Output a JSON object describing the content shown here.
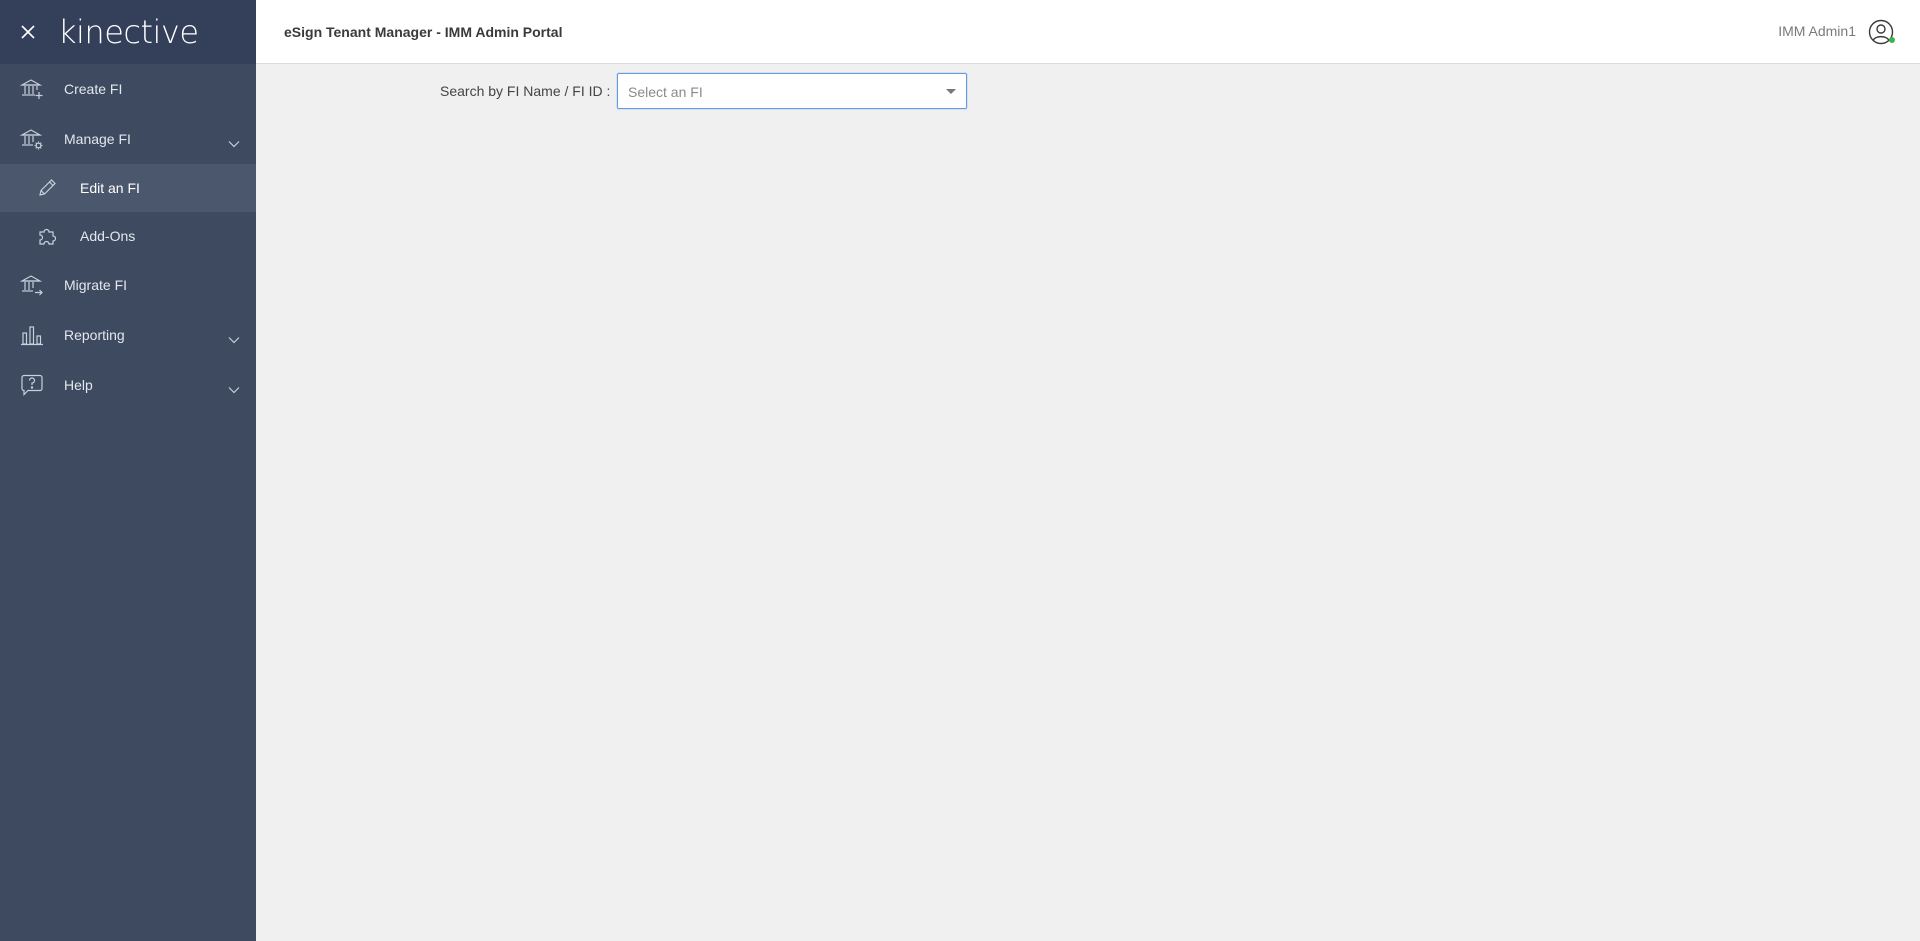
{
  "app": {
    "logo": "kinective",
    "title": "eSign Tenant Manager - IMM Admin Portal"
  },
  "user": {
    "name": "IMM Admin1"
  },
  "sidebar": {
    "items": [
      {
        "label": "Create FI",
        "icon": "bank-add-icon"
      },
      {
        "label": "Manage FI",
        "icon": "bank-settings-icon",
        "expandable": true
      },
      {
        "label": "Edit an FI",
        "icon": "pencil-icon",
        "sub": true,
        "active": true
      },
      {
        "label": "Add-Ons",
        "icon": "puzzle-icon",
        "sub": true
      },
      {
        "label": "Migrate FI",
        "icon": "bank-migrate-icon"
      },
      {
        "label": "Reporting",
        "icon": "bar-chart-icon",
        "expandable": true
      },
      {
        "label": "Help",
        "icon": "help-chat-icon",
        "expandable": true
      }
    ]
  },
  "search": {
    "label": "Search by FI Name / FI ID :",
    "placeholder": "Select an FI"
  },
  "colors": {
    "sidebar_bg": "#3d4a5f",
    "sidebar_header_bg": "#34405a",
    "active_item_bg": "#4b576c",
    "focus_border": "#6a9ae0",
    "status_online": "#3cb44b"
  }
}
